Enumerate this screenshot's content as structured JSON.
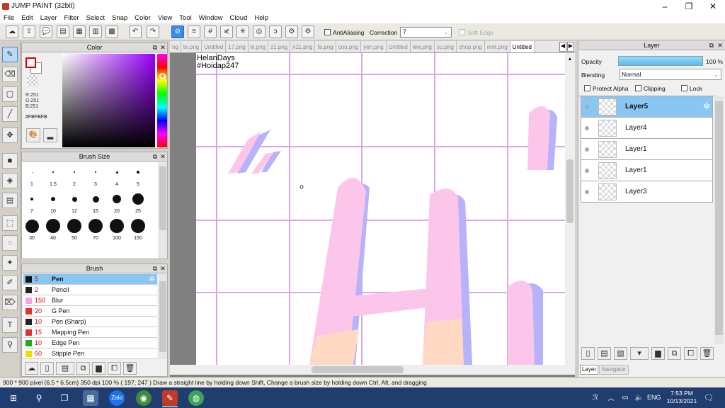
{
  "window": {
    "title": "JUMP PAINT (32bit)"
  },
  "menu": [
    "File",
    "Edit",
    "Layer",
    "Filter",
    "Select",
    "Snap",
    "Color",
    "View",
    "Tool",
    "Window",
    "Cloud",
    "Help"
  ],
  "toolbar": {
    "antialias_label": "AntiAliasing",
    "correction_label": "Correction",
    "correction_value": "7",
    "softedge_label": "Soft Edge"
  },
  "color_panel": {
    "title": "Color",
    "r": "R:251",
    "g": "G:251",
    "b": "B:251",
    "hex": "#FBFBFB"
  },
  "brush_size_panel": {
    "title": "Brush Size",
    "sizes": [
      "1",
      "1.5",
      "2",
      "3",
      "4",
      "5",
      "7",
      "10",
      "12",
      "15",
      "20",
      "25",
      "30",
      "40",
      "50",
      "70",
      "100",
      "150"
    ]
  },
  "brush_panel": {
    "title": "Brush",
    "items": [
      {
        "size": "5",
        "name": "Pen",
        "color": "#111111"
      },
      {
        "size": "2",
        "name": "Pencil",
        "color": "#222222"
      },
      {
        "size": "150",
        "name": "Blur",
        "color": "#f6a4e8"
      },
      {
        "size": "20",
        "name": "G Pen",
        "color": "#e03030"
      },
      {
        "size": "10",
        "name": "Pen (Sharp)",
        "color": "#222222"
      },
      {
        "size": "15",
        "name": "Mapping Pen",
        "color": "#e03030"
      },
      {
        "size": "10",
        "name": "Edge Pen",
        "color": "#22aa22"
      },
      {
        "size": "50",
        "name": "Stipple Pen",
        "color": "#e8e000"
      }
    ]
  },
  "tabs": [
    "ng",
    "te.png",
    "Untitled",
    "17.png",
    "ki.png",
    "z1.png",
    "n11.png",
    "fa.png",
    "cou.png",
    "yen.png",
    "Untitled",
    "lew.png",
    "su.png",
    "chop.png",
    "mot.png",
    "Untitled"
  ],
  "canvas": {
    "line1": "HelanDays",
    "line2": "#Hoidap247"
  },
  "layer_panel": {
    "title": "Layer",
    "opacity_label": "Opacity",
    "opacity_value": "100 %",
    "opacity": 1.0,
    "blending_label": "Blending",
    "blending_value": "Normal",
    "protect_alpha": "Protect Alpha",
    "clipping": "Clipping",
    "lock": "Lock",
    "layers": [
      "Layer5",
      "Layer4",
      "Layer1",
      "Layer1",
      "Layer3"
    ],
    "bottom_tabs": [
      "Layer",
      "Navigator"
    ]
  },
  "status": "900 * 900 pixel   (6.5 * 6.5cm)   350 dpi   100 %   ( 197, 247 )   Draw a straight line by holding down Shift, Change a brush size by holding down Ctrl, Alt, and dragging",
  "taskbar": {
    "lang": "ENG",
    "time": "7:53 PM",
    "date": "10/13/2021"
  }
}
